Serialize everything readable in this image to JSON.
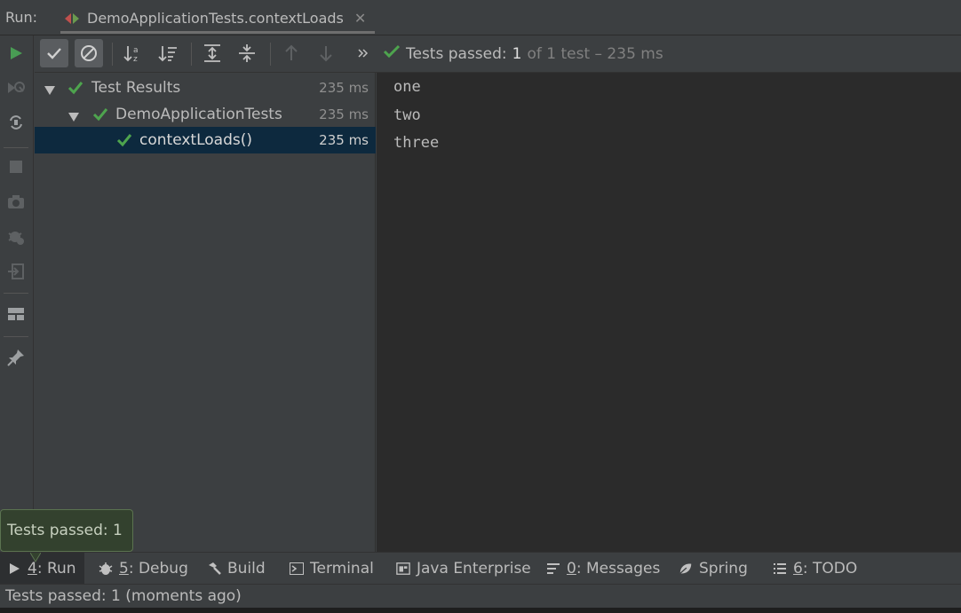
{
  "run_header": {
    "label": "Run:",
    "tab_title": "DemoApplicationTests.contextLoads",
    "close_glyph": "✕"
  },
  "toolbar": {
    "icons": [
      "rerun-icon",
      "show-passed-icon",
      "show-ignored-icon",
      "sort-alpha-icon",
      "sort-duration-icon",
      "expand-all-icon",
      "collapse-all-icon",
      "prev-failed-icon",
      "next-failed-icon",
      "more-icon"
    ],
    "status_passed": "Tests passed:",
    "status_count": "1",
    "status_rest": "of 1 test – 235 ms"
  },
  "tree": {
    "rows": [
      {
        "label": "Test Results",
        "time": "235 ms"
      },
      {
        "label": "DemoApplicationTests",
        "time": "235 ms"
      },
      {
        "label": "contextLoads()",
        "time": "235 ms"
      }
    ]
  },
  "console": {
    "lines": [
      "one",
      "two",
      "three"
    ]
  },
  "tooltip": {
    "text": "Tests passed: 1"
  },
  "tool_tabs": [
    {
      "num": "4",
      "rest": ": Run",
      "icon": "run-icon"
    },
    {
      "num": "5",
      "rest": ": Debug",
      "icon": "debug-icon"
    },
    {
      "num": "",
      "rest": "Build",
      "icon": "build-icon"
    },
    {
      "num": "",
      "rest": "Terminal",
      "icon": "terminal-icon"
    },
    {
      "num": "",
      "rest": "Java Enterprise",
      "icon": "java-enterprise-icon"
    },
    {
      "num": "0",
      "rest": ": Messages",
      "icon": "messages-icon"
    },
    {
      "num": "",
      "rest": "Spring",
      "icon": "spring-icon"
    },
    {
      "num": "6",
      "rest": ": TODO",
      "icon": "todo-icon"
    }
  ],
  "status_bar": {
    "text": "Tests passed: 1 (moments ago)"
  },
  "colors": {
    "pass_green": "#4ea44e",
    "selection": "#0d293e",
    "console_bg": "#2b2b2b",
    "panel_bg": "#3c3f41"
  }
}
